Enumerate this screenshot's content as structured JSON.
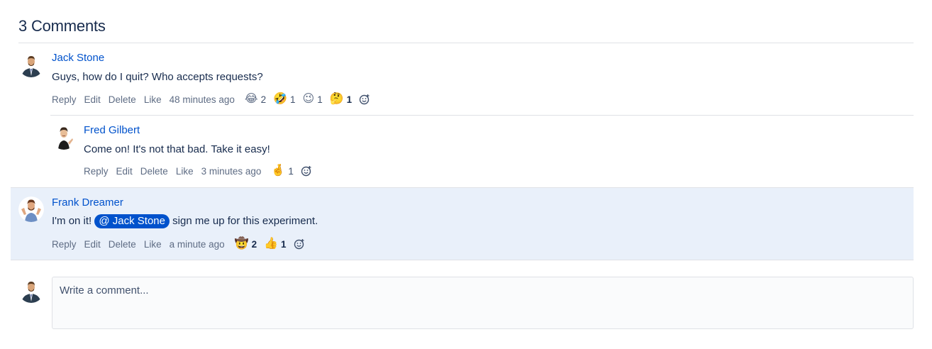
{
  "heading": "3 Comments",
  "comments": [
    {
      "author": "Jack Stone",
      "text": "Guys, how do I quit? Who accepts requests?",
      "actions": [
        "Reply",
        "Edit",
        "Delete",
        "Like"
      ],
      "time": "48 minutes ago",
      "reactions": [
        {
          "emoji": "😂",
          "count": "2"
        },
        {
          "emoji": "🤣",
          "count": "1"
        },
        {
          "emoji": "😉",
          "count": "1"
        },
        {
          "emoji": "🤔",
          "count": "1"
        }
      ]
    },
    {
      "author": "Fred Gilbert",
      "text": "Come on! It's not that bad. Take it easy!",
      "actions": [
        "Reply",
        "Edit",
        "Delete",
        "Like"
      ],
      "time": "3 minutes ago",
      "reactions": [
        {
          "emoji": "🤞",
          "count": "1"
        }
      ]
    },
    {
      "author": "Frank Dreamer",
      "text_before": "I'm on it!",
      "mention": "@ Jack Stone",
      "text_after": "sign me up for this experiment.",
      "actions": [
        "Reply",
        "Edit",
        "Delete",
        "Like"
      ],
      "time": "a minute ago",
      "reactions": [
        {
          "emoji": "🤠",
          "count": "2"
        },
        {
          "emoji": "👍",
          "count": "1"
        }
      ]
    }
  ],
  "composer": {
    "placeholder": "Write a comment..."
  },
  "icons": {
    "add_reaction": "add-reaction-icon"
  },
  "colors": {
    "link": "#0052cc",
    "mention_bg": "#0052cc",
    "highlight_bg": "#e9f0fa",
    "text": "#172b4d",
    "muted": "#5e6c84"
  }
}
